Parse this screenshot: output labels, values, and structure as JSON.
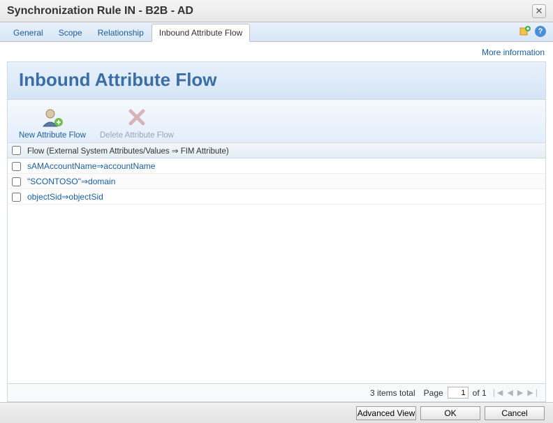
{
  "header": {
    "title": "Synchronization Rule IN - B2B - AD"
  },
  "tabs": [
    {
      "label": "General"
    },
    {
      "label": "Scope"
    },
    {
      "label": "Relationship"
    },
    {
      "label": "Inbound Attribute Flow"
    }
  ],
  "moreInfo": "More information",
  "panel": {
    "title": "Inbound Attribute Flow"
  },
  "toolbar": {
    "newFlow": "New Attribute Flow",
    "deleteFlow": "Delete Attribute Flow"
  },
  "grid": {
    "header": "Flow (External System Attributes/Values ⇒ FIM Attribute)",
    "rows": [
      {
        "text": "sAMAccountName⇒accountName"
      },
      {
        "text": "\"SCONTOSO\"⇒domain"
      },
      {
        "text": "objectSid⇒objectSid"
      }
    ]
  },
  "pager": {
    "totalText": "3 items total",
    "pageLabel": "Page",
    "pageNum": "1",
    "ofText": "of 1"
  },
  "footer": {
    "advanced": "Advanced View",
    "ok": "OK",
    "cancel": "Cancel"
  }
}
